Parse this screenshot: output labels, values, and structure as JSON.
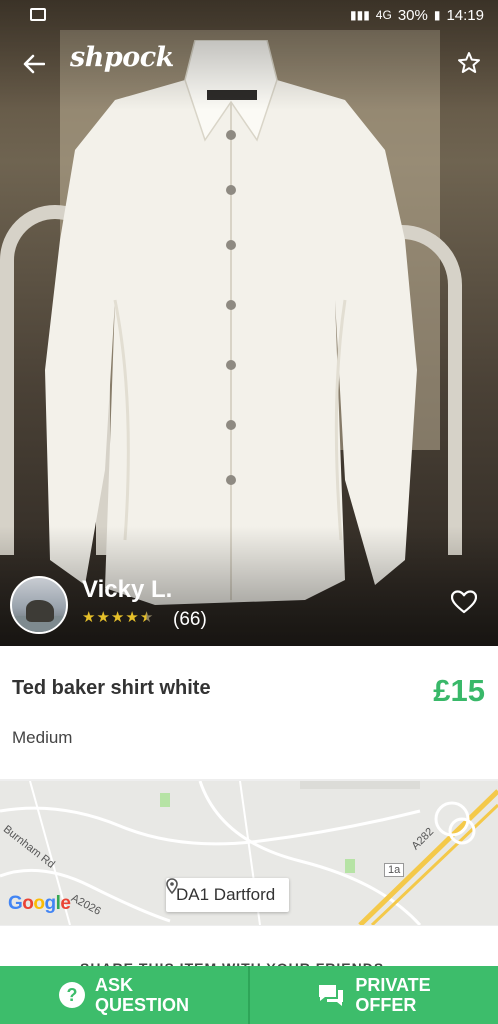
{
  "statusbar": {
    "battery": "30%",
    "time": "14:19",
    "network": "4G"
  },
  "toolbar": {
    "logo": "shpock",
    "back_icon": "arrow-left-icon",
    "favorite_icon": "star-outline-icon"
  },
  "seller": {
    "name": "Vicky L.",
    "rating": 4.5,
    "reviews": "(66)"
  },
  "item": {
    "title": "Ted baker shirt white",
    "price": "£15",
    "size": "Medium"
  },
  "map": {
    "location": "DA1 Dartford",
    "road_labels": [
      "Burnham Rd",
      "A2026",
      "A282",
      "1a"
    ],
    "attribution": "Google"
  },
  "share": {
    "label": "SHARE THIS ITEM WITH YOUR FRIENDS"
  },
  "actions": {
    "ask_line1": "ASK",
    "ask_line2": "QUESTION",
    "offer_line1": "PRIVATE",
    "offer_line2": "OFFER"
  },
  "colors": {
    "accent": "#3dbd6b",
    "price": "#39b869",
    "stars": "#e6c02a"
  }
}
